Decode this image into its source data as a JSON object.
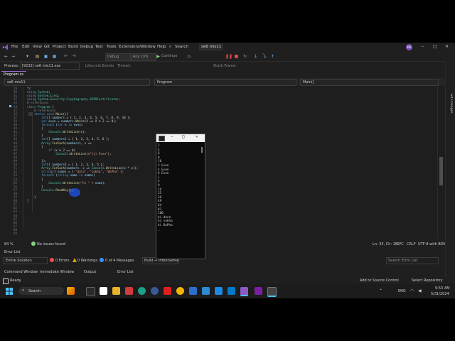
{
  "menu": {
    "items": [
      "File",
      "Edit",
      "View",
      "Git",
      "Project",
      "Build",
      "Debug",
      "Test",
      "Tools",
      "Extensions",
      "Window",
      "Help"
    ],
    "search": "Search",
    "solution": "se6 mis11",
    "account_initials": "MA"
  },
  "toolbar": {
    "config": "Debug",
    "platform": "Any CPU",
    "continue": "Continue"
  },
  "process_bar": {
    "label": "Process:",
    "process": "[9232] se6 mis11.exe",
    "lifecycle": "Lifecycle Events",
    "thread": "Thread:",
    "stack_frame": "Stack Frame:"
  },
  "tabs": {
    "active": "Program.cs"
  },
  "navbar": {
    "project": "se6 mis11",
    "class": "Program",
    "member": "Main()"
  },
  "editor": {
    "line_numbers": [
      "29",
      "30",
      "31",
      "32",
      "33",
      "34",
      "35",
      "36",
      "37",
      "38",
      "39",
      "40",
      "41",
      "42",
      "43",
      "44",
      "45",
      "46",
      "47",
      "48",
      "49",
      "50",
      "51",
      "52",
      "53",
      "54",
      "55",
      "56",
      "57",
      "58",
      "59",
      "60",
      "61",
      "62",
      "63",
      "64",
      "65",
      "66",
      "67",
      "68",
      "69"
    ],
    "lines": [
      "*/",
      "using System;",
      "using System.Linq;",
      "using System.Security.Cryptography.X509Certificates;",
      "0 references",
      "class Program {",
      "    0 references",
      "    static void Main(){",
      "        int[] numbers = { 1, 2, 3, 4, 5, 6, 7, 8, 9, 10 };",
      "        var even = numbers.Where(X => X % 2 == 0);",
      "        foreach (var n in even)",
      "        {",
      "            Console.WriteLine(n);",
      "        }",
      "        int[] numbers1 = { 1, 2, 3, 4, 5, 6 };",
      "        Array.ForEach(numbers1, x =>",
      "        {",
      "            if (x % 2 == 0)",
      "                Console.WriteLine($\"{x} Even\");",
      "",
      "        });",
      "        int[] numbers3 = { 1, 2, 3, 4, 5 };",
      "        Array.ForEach(numbers, x => Console.WriteLine(x * x));",
      "        string[] names = { \"dara\", \"sokha\", \"BoPha\" };",
      "        foreach (string name in names)",
      "        {",
      "            Console.WriteLine(\"hi \" + name);",
      "        }",
      "        Console.ReadKey();",
      "",
      "    }",
      "}",
      "",
      "",
      "",
      "",
      "",
      "",
      "",
      "",
      ""
    ]
  },
  "editor_status": {
    "zoom": "84 %",
    "issues": "No issues found",
    "position": "Ln: 33, Ch: 16",
    "spc": "SPC",
    "crlf": "CRLF",
    "encoding": "UTF-8 with BOM"
  },
  "error_list": {
    "title": "Error List",
    "scope": "Entire Solution",
    "errors": "0 Errors",
    "warnings": "0 Warnings",
    "messages": "0 of 4 Messages",
    "build": "Build + IntelliSense",
    "search": "Search Error List"
  },
  "bottom_tabs": [
    "Command Window",
    "Immediate Window",
    "Output",
    "Error List"
  ],
  "status": {
    "ready": "Ready",
    "source_control": "Add to Source Control",
    "repository": "Select Repository"
  },
  "console": {
    "lines": [
      "2",
      "4",
      "6",
      "8",
      "10",
      "2 Even",
      "4 Even",
      "6 Even",
      "1",
      "4",
      "9",
      "16",
      "25",
      "36",
      "49",
      "64",
      "81",
      "100",
      "hi dara",
      "hi sokha",
      "hi BoPha",
      "_"
    ]
  },
  "right_rail": {
    "label": "Git Changes"
  },
  "taskbar": {
    "search": "Search",
    "lang": "ENG",
    "time": "9:53 AM",
    "date": "5/31/2024"
  },
  "colors": {
    "accent": "#9b6bd1",
    "keyword": "#569cd6",
    "type": "#4ec9b0",
    "string": "#d69d85",
    "method": "#dcdcaa",
    "variable": "#9cdcfe"
  }
}
